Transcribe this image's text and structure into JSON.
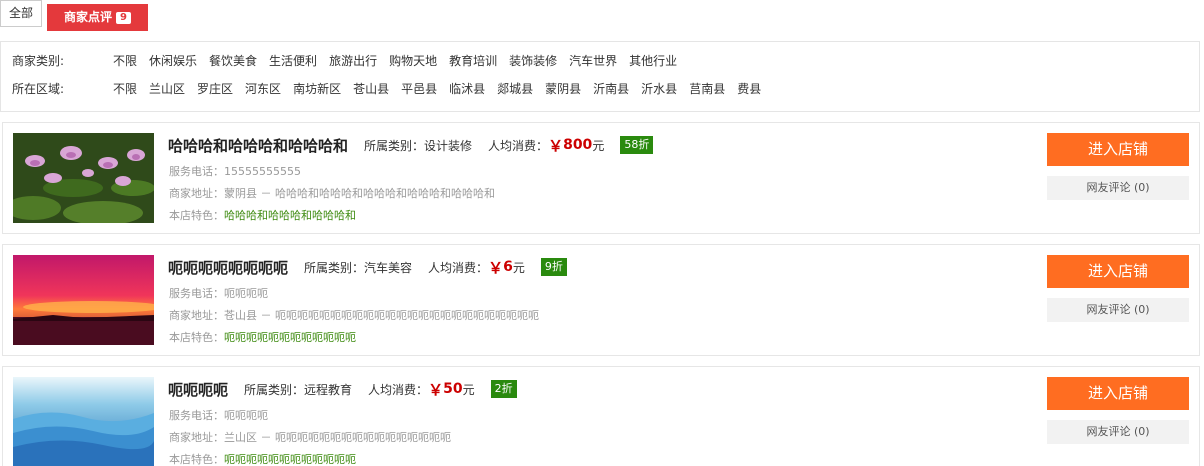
{
  "tabs": {
    "all": "全部",
    "review": "商家点评",
    "review_count": "9"
  },
  "filters": {
    "category_label": "商家类别:",
    "categories": [
      "不限",
      "休闲娱乐",
      "餐饮美食",
      "生活便利",
      "旅游出行",
      "购物天地",
      "教育培训",
      "装饰装修",
      "汽车世界",
      "其他行业"
    ],
    "area_label": "所在区域:",
    "areas": [
      "不限",
      "兰山区",
      "罗庄区",
      "河东区",
      "南坊新区",
      "苍山县",
      "平邑县",
      "临沭县",
      "郯城县",
      "蒙阴县",
      "沂南县",
      "沂水县",
      "莒南县",
      "费县"
    ]
  },
  "shops": [
    {
      "name": "哈哈哈和哈哈哈和哈哈哈和",
      "category_label": "所属类别：",
      "category": "设计装修",
      "price_label": "人均消费：",
      "yen": "￥",
      "price": "800",
      "unit": "元",
      "discount": "58折",
      "phone": "服务电话：15555555555",
      "address": "商家地址：蒙阴县 － 哈哈哈和哈哈哈和哈哈哈和哈哈哈和哈哈哈和",
      "feature_label": "本店特色：",
      "feature": "哈哈哈和哈哈哈和哈哈哈和",
      "enter": "进入店铺",
      "review": "网友评论 (0)"
    },
    {
      "name": "呃呃呃呃呃呃呃呃",
      "category_label": "所属类别：",
      "category": "汽车美容",
      "price_label": "人均消费：",
      "yen": "￥",
      "price": "6",
      "unit": "元",
      "discount": "9折",
      "phone": "服务电话：呃呃呃呃",
      "address": "商家地址：苍山县 － 呃呃呃呃呃呃呃呃呃呃呃呃呃呃呃呃呃呃呃呃呃呃呃呃",
      "feature_label": "本店特色：",
      "feature": "呃呃呃呃呃呃呃呃呃呃呃呃",
      "enter": "进入店铺",
      "review": "网友评论 (0)"
    },
    {
      "name": "呃呃呃呃",
      "category_label": "所属类别：",
      "category": "远程教育",
      "price_label": "人均消费：",
      "yen": "￥",
      "price": "50",
      "unit": "元",
      "discount": "2折",
      "phone": "服务电话：呃呃呃呃",
      "address": "商家地址：兰山区 － 呃呃呃呃呃呃呃呃呃呃呃呃呃呃呃呃",
      "feature_label": "本店特色：",
      "feature": "呃呃呃呃呃呃呃呃呃呃呃呃",
      "enter": "进入店铺",
      "review": "网友评论 (0)"
    }
  ]
}
